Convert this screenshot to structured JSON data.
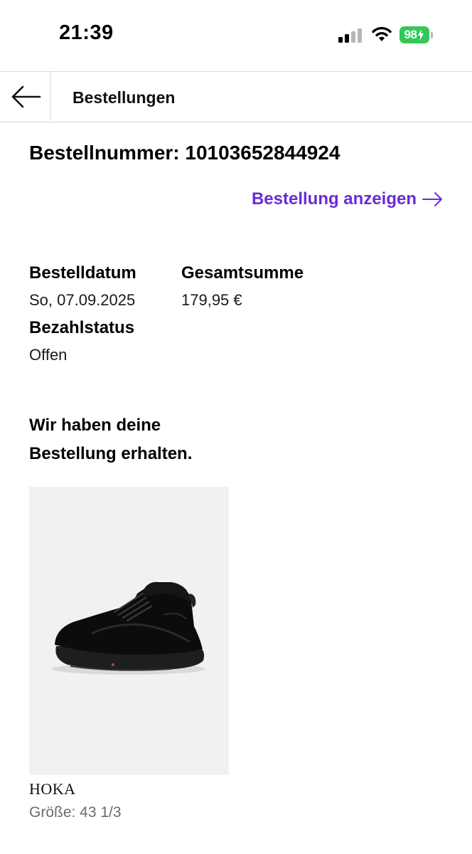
{
  "status_bar": {
    "time": "21:39",
    "battery_level": "98",
    "battery_color": "#34c759",
    "signal_bars_active": 2,
    "signal_bars_total": 4,
    "icons": [
      "cellular-signal-icon",
      "wifi-icon",
      "battery-charging-icon"
    ]
  },
  "nav": {
    "back_icon": "arrow-left-icon",
    "title": "Bestellungen"
  },
  "order": {
    "number_text": "Bestellnummer: 10103652844924",
    "view_link": "Bestellung anzeigen",
    "link_icon": "arrow-right-icon",
    "accent_color": "#6a2bd8",
    "date_label": "Bestelldatum",
    "date_value": "So, 07.09.2025",
    "total_label": "Gesamtsumme",
    "total_value": "179,95 €",
    "payment_label": "Bezahlstatus",
    "payment_value": "Offen",
    "received_message": "Wir haben deine Bestellung erhalten."
  },
  "product": {
    "image_icon": "black-hiking-boot-image",
    "brand": "HOKA",
    "size": "Größe: 43 1/3"
  }
}
